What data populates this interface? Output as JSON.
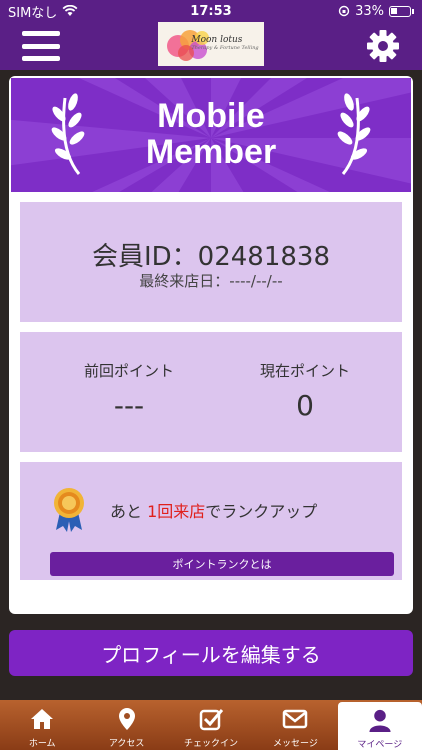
{
  "status_bar": {
    "carrier": "SIMなし",
    "time": "17:53",
    "battery": "33%"
  },
  "header": {
    "logo_text": "Moon lotus",
    "logo_sub": "Therapy & Fortune Telling",
    "menu_icon": "hamburger-icon",
    "settings_icon": "gear-icon"
  },
  "banner": {
    "title_line1": "Mobile",
    "title_line2": "Member"
  },
  "member": {
    "id_label": "会員ID：02481838",
    "last_visit": "最終来店日：----/--/--"
  },
  "points": {
    "previous_label": "前回ポイント",
    "previous_value": "---",
    "current_label": "現在ポイント",
    "current_value": "0"
  },
  "rank": {
    "prefix": "あと ",
    "highlight": "1回来店",
    "suffix": "でランクアップ",
    "button_label": "ポイントランクとは"
  },
  "profile_button": "プロフィールを編集する",
  "tabs": [
    {
      "label": "ホーム",
      "icon": "home-icon"
    },
    {
      "label": "アクセス",
      "icon": "map-pin-icon"
    },
    {
      "label": "チェックイン",
      "icon": "checkin-icon"
    },
    {
      "label": "メッセージ",
      "icon": "mail-icon"
    },
    {
      "label": "マイページ",
      "icon": "user-icon"
    }
  ],
  "colors": {
    "header_purple": "#5a1f86",
    "banner_purple": "#7e2ec7",
    "panel_lavender": "#dcc5ee",
    "highlight_red": "#e0201c",
    "tabbar_orange": "#b8622e"
  }
}
